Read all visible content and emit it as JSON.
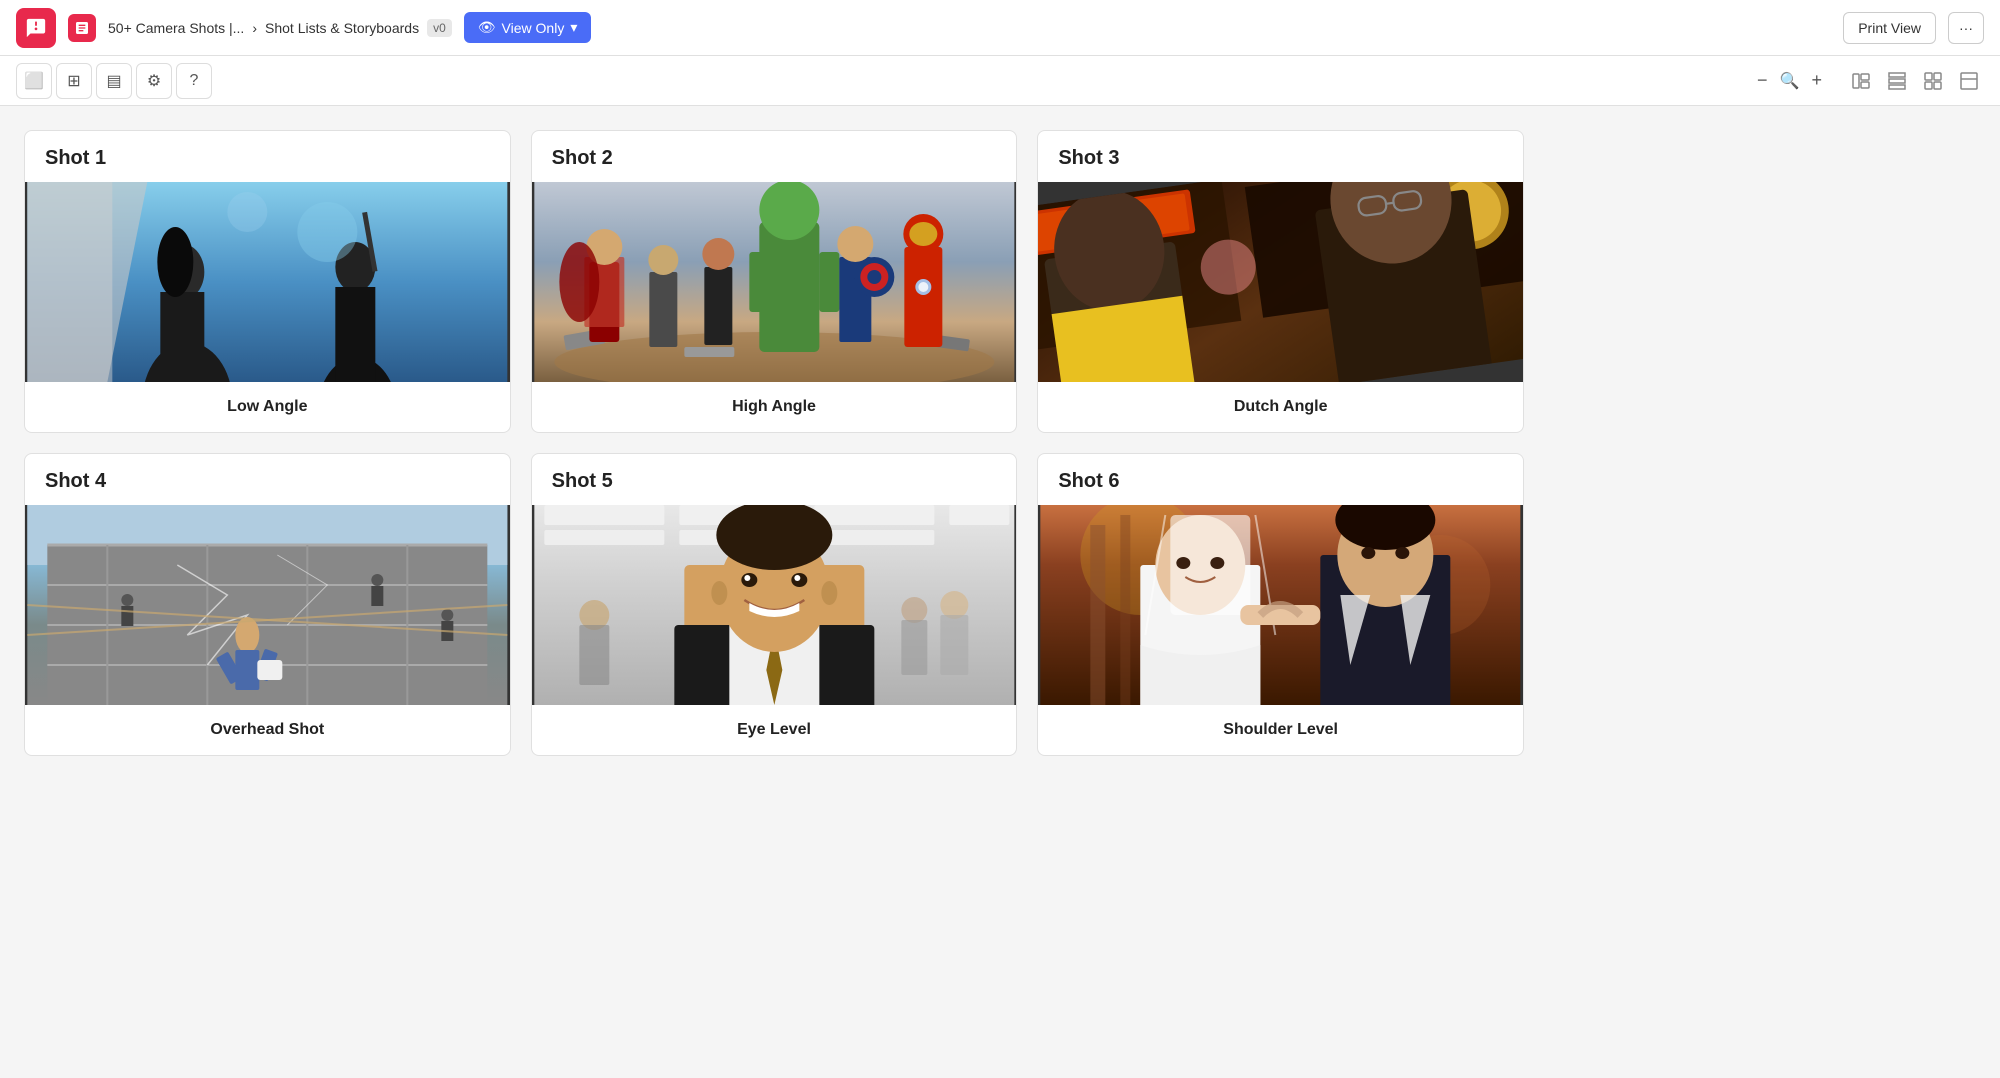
{
  "header": {
    "logo_alt": "StudioBinder",
    "project_title": "50+ Camera Shots |...",
    "breadcrumb_separator": "›",
    "section_title": "Shot Lists & Storyboards",
    "version": "v0",
    "view_mode_label": "View Only",
    "print_button": "Print View",
    "more_button": "···"
  },
  "toolbar": {
    "tools": [
      {
        "name": "frame-tool",
        "icon": "⬜"
      },
      {
        "name": "grid-tool",
        "icon": "⊞"
      },
      {
        "name": "layout-tool",
        "icon": "▤"
      },
      {
        "name": "settings-tool",
        "icon": "⚙"
      },
      {
        "name": "help-tool",
        "icon": "?"
      }
    ],
    "zoom_minus": "−",
    "zoom_plus": "+",
    "view_modes": [
      "list-view",
      "grid-view",
      "tile-view",
      "card-view"
    ]
  },
  "shots": [
    {
      "id": "shot-1",
      "title": "Shot 1",
      "label": "Low Angle",
      "scene_type": "low_angle"
    },
    {
      "id": "shot-2",
      "title": "Shot 2",
      "label": "High Angle",
      "scene_type": "high_angle"
    },
    {
      "id": "shot-3",
      "title": "Shot 3",
      "label": "Dutch Angle",
      "scene_type": "dutch_angle"
    },
    {
      "id": "shot-4",
      "title": "Shot 4",
      "label": "Overhead Shot",
      "scene_type": "overhead"
    },
    {
      "id": "shot-5",
      "title": "Shot 5",
      "label": "Eye Level",
      "scene_type": "eye_level"
    },
    {
      "id": "shot-6",
      "title": "Shot 6",
      "label": "Shoulder Level",
      "scene_type": "shoulder_level"
    }
  ]
}
